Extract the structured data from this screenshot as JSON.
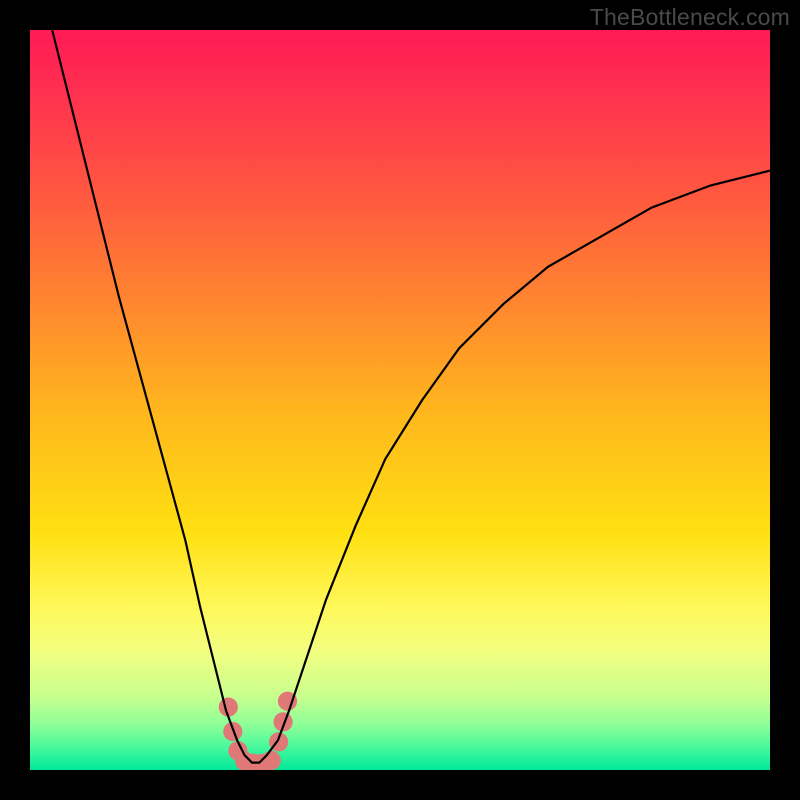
{
  "watermark": "TheBottleneck.com",
  "chart_data": {
    "type": "line",
    "title": "",
    "xlabel": "",
    "ylabel": "",
    "xlim": [
      0,
      100
    ],
    "ylim": [
      0,
      100
    ],
    "series": [
      {
        "name": "curve",
        "x": [
          3,
          6,
          9,
          12,
          15,
          18,
          21,
          23,
          25,
          26.5,
          28,
          29,
          30,
          31,
          32,
          33.5,
          35,
          37,
          40,
          44,
          48,
          53,
          58,
          64,
          70,
          77,
          84,
          92,
          100
        ],
        "y": [
          100,
          88,
          76,
          64,
          53,
          42,
          31,
          22,
          14,
          8,
          4,
          2,
          1,
          1,
          2,
          4,
          8,
          14,
          23,
          33,
          42,
          50,
          57,
          63,
          68,
          72,
          76,
          79,
          81
        ]
      }
    ],
    "markers": [
      {
        "name": "left-dot-top",
        "x": 26.8,
        "y": 8.5
      },
      {
        "name": "left-dot-mid",
        "x": 27.4,
        "y": 5.2
      },
      {
        "name": "left-dot-low",
        "x": 28.1,
        "y": 2.6
      },
      {
        "name": "bottom-dot-1",
        "x": 29.0,
        "y": 1.2
      },
      {
        "name": "bottom-dot-2",
        "x": 30.2,
        "y": 0.9
      },
      {
        "name": "bottom-dot-3",
        "x": 31.4,
        "y": 0.9
      },
      {
        "name": "bottom-dot-4",
        "x": 32.6,
        "y": 1.3
      },
      {
        "name": "right-dot-low",
        "x": 33.6,
        "y": 3.8
      },
      {
        "name": "right-dot-mid",
        "x": 34.2,
        "y": 6.5
      },
      {
        "name": "right-dot-top",
        "x": 34.8,
        "y": 9.3
      }
    ],
    "marker_color": "#e07878",
    "marker_radius_pct": 1.3
  }
}
